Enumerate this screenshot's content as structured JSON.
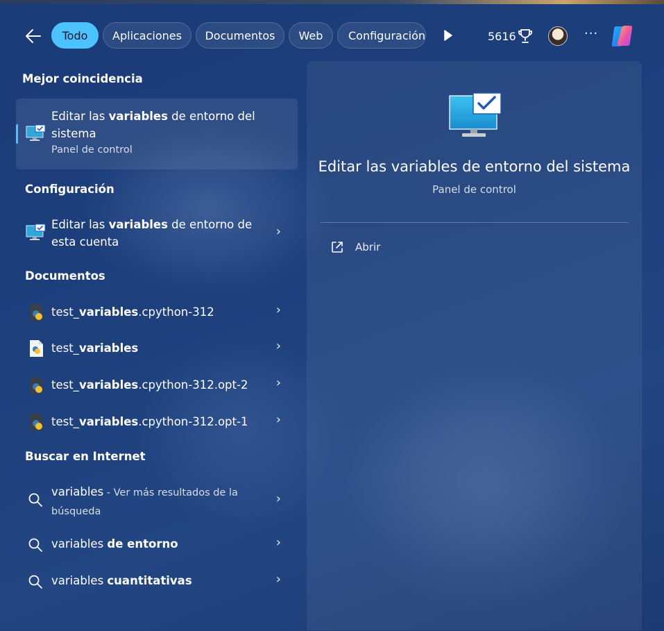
{
  "filters": [
    "Todo",
    "Aplicaciones",
    "Documentos",
    "Web",
    "Configuración"
  ],
  "points": "5616",
  "sections": {
    "best": "Mejor coincidencia",
    "settings": "Configuración",
    "documents": "Documentos",
    "internet": "Buscar en Internet"
  },
  "best_match": {
    "title_pre": "Editar las ",
    "title_bold": "variables",
    "title_post": " de entorno del sistema",
    "subtitle": "Panel de control"
  },
  "settings_item": {
    "title_pre": "Editar las ",
    "title_bold": "variables",
    "title_post": " de entorno de esta cuenta"
  },
  "documents": [
    {
      "pre": "test_",
      "bold": "variables",
      "post": ".cpython-312"
    },
    {
      "pre": "test_",
      "bold": "variables",
      "post": ""
    },
    {
      "pre": "test_",
      "bold": "variables",
      "post": ".cpython-312.opt-2"
    },
    {
      "pre": "test_",
      "bold": "variables",
      "post": ".cpython-312.opt-1"
    }
  ],
  "internet": [
    {
      "text": "variables",
      "suffix": " - Ver más resultados de la búsqueda"
    },
    {
      "text": "variables ",
      "bold": "de entorno"
    },
    {
      "text": "variables ",
      "bold": "cuantitativas"
    }
  ],
  "preview": {
    "title": "Editar las variables de entorno del sistema",
    "subtitle": "Panel de control",
    "open_label": "Abrir"
  },
  "colors": {
    "accent": "#4cc2ff"
  }
}
